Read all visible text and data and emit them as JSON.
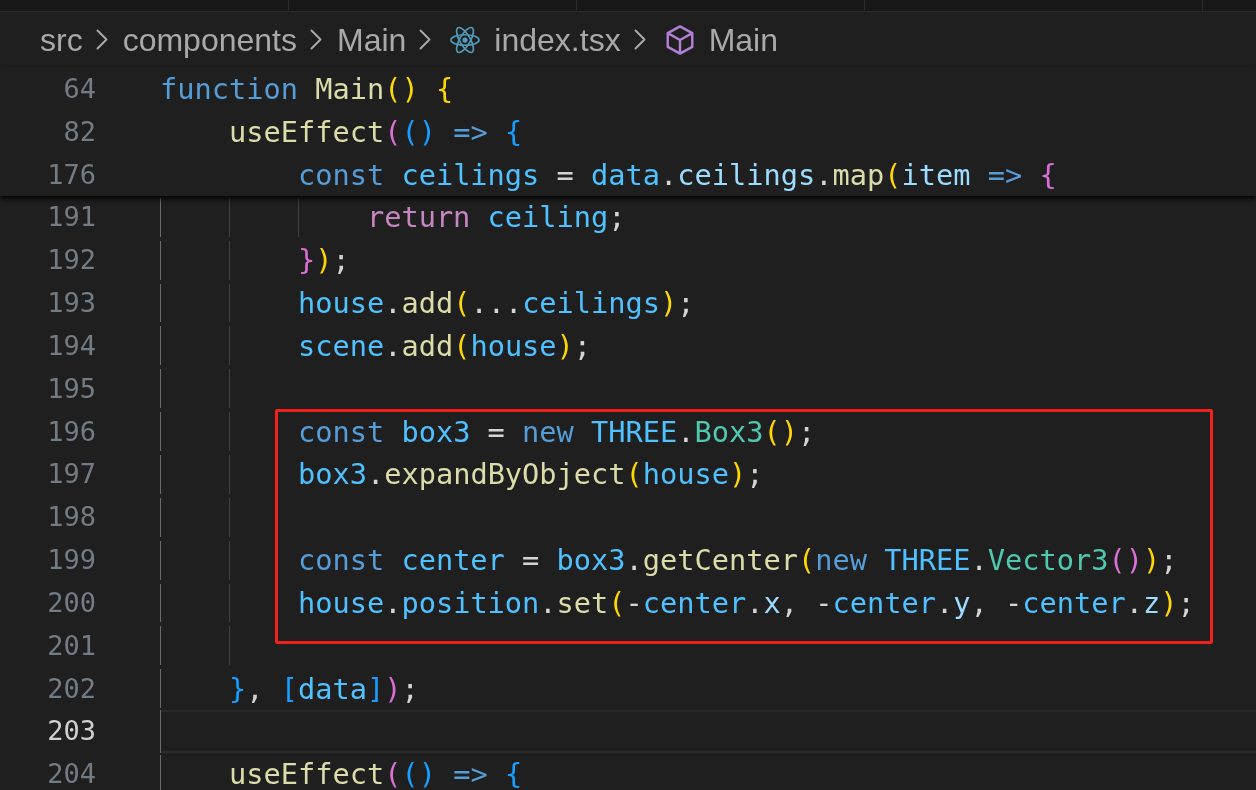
{
  "breadcrumb": [
    {
      "label": "src",
      "kind": "folder"
    },
    {
      "label": "components",
      "kind": "folder"
    },
    {
      "label": "Main",
      "kind": "folder"
    },
    {
      "label": "index.tsx",
      "kind": "file"
    },
    {
      "label": "Main",
      "kind": "symbol"
    }
  ],
  "code": [
    {
      "number": "64",
      "sticky": true,
      "current": false,
      "tokens": [
        {
          "text": "function",
          "kind": "keyword"
        },
        {
          "text": " Main",
          "kind": "function"
        },
        {
          "text": "()",
          "kind": "bracket1"
        },
        {
          "text": " {",
          "kind": "bracket1"
        }
      ],
      "children": [
        {
          "number": "82",
          "sticky": true,
          "current": false,
          "tokens": [
            {
              "text": "useEffect",
              "kind": "function"
            },
            {
              "text": "(",
              "kind": "bracket2"
            },
            {
              "text": "()",
              "kind": "bracket3"
            },
            {
              "text": " =>",
              "kind": "keyword"
            },
            {
              "text": " {",
              "kind": "bracket3"
            }
          ],
          "children": [
            {
              "kind": "line",
              "number": "176",
              "sticky": true,
              "current": false,
              "tokens": [
                {
                  "text": "const",
                  "kind": "keyword"
                },
                {
                  "text": " ceilings",
                  "kind": "constant"
                },
                {
                  "text": " = ",
                  "kind": "punctuation"
                },
                {
                  "text": "data",
                  "kind": "constant"
                },
                {
                  "text": ".",
                  "kind": "punctuation"
                },
                {
                  "text": "ceilings",
                  "kind": "property"
                },
                {
                  "text": ".",
                  "kind": "punctuation"
                },
                {
                  "text": "map",
                  "kind": "function"
                },
                {
                  "text": "(",
                  "kind": "bracket1"
                },
                {
                  "text": "item",
                  "kind": "property"
                },
                {
                  "text": " =>",
                  "kind": "keyword"
                },
                {
                  "text": " {",
                  "kind": "bracket2"
                }
              ],
              "children": [
                {
                  "number": "191",
                  "sticky": false,
                  "current": false,
                  "tokens": [
                    {
                      "text": "return",
                      "kind": "control"
                    },
                    {
                      "text": " ceiling",
                      "kind": "constant"
                    },
                    {
                      "text": ";",
                      "kind": "punctuation"
                    }
                  ]
                }
              ]
            },
            {
              "kind": "line",
              "number": "192",
              "sticky": false,
              "current": false,
              "tokens": [
                {
                  "text": "}",
                  "kind": "bracket2"
                },
                {
                  "text": ")",
                  "kind": "bracket1"
                },
                {
                  "text": ";",
                  "kind": "punctuation"
                }
              ]
            },
            {
              "kind": "line",
              "number": "193",
              "sticky": false,
              "current": false,
              "tokens": [
                {
                  "text": "house",
                  "kind": "constant"
                },
                {
                  "text": ".",
                  "kind": "punctuation"
                },
                {
                  "text": "add",
                  "kind": "function"
                },
                {
                  "text": "(",
                  "kind": "bracket1"
                },
                {
                  "text": "...",
                  "kind": "punctuation"
                },
                {
                  "text": "ceilings",
                  "kind": "constant"
                },
                {
                  "text": ")",
                  "kind": "bracket1"
                },
                {
                  "text": ";",
                  "kind": "punctuation"
                }
              ]
            },
            {
              "kind": "line",
              "number": "194",
              "sticky": false,
              "current": false,
              "tokens": [
                {
                  "text": "scene",
                  "kind": "constant"
                },
                {
                  "text": ".",
                  "kind": "punctuation"
                },
                {
                  "text": "add",
                  "kind": "function"
                },
                {
                  "text": "(",
                  "kind": "bracket1"
                },
                {
                  "text": "house",
                  "kind": "constant"
                },
                {
                  "text": ")",
                  "kind": "bracket1"
                },
                {
                  "text": ";",
                  "kind": "punctuation"
                }
              ]
            },
            {
              "kind": "line",
              "number": "195",
              "sticky": false,
              "current": false
            },
            {
              "kind": "highlight",
              "lines": [
                {
                  "number": "196",
                  "sticky": false,
                  "current": false,
                  "tokens": [
                    {
                      "text": "const",
                      "kind": "keyword"
                    },
                    {
                      "text": " box3",
                      "kind": "constant"
                    },
                    {
                      "text": " = ",
                      "kind": "punctuation"
                    },
                    {
                      "text": "new",
                      "kind": "keyword"
                    },
                    {
                      "text": " THREE",
                      "kind": "constant"
                    },
                    {
                      "text": ".",
                      "kind": "punctuation"
                    },
                    {
                      "text": "Box3",
                      "kind": "class"
                    },
                    {
                      "text": "()",
                      "kind": "bracket1"
                    },
                    {
                      "text": ";",
                      "kind": "punctuation"
                    }
                  ]
                },
                {
                  "number": "197",
                  "sticky": false,
                  "current": false,
                  "tokens": [
                    {
                      "text": "box3",
                      "kind": "constant"
                    },
                    {
                      "text": ".",
                      "kind": "punctuation"
                    },
                    {
                      "text": "expandByObject",
                      "kind": "function"
                    },
                    {
                      "text": "(",
                      "kind": "bracket1"
                    },
                    {
                      "text": "house",
                      "kind": "constant"
                    },
                    {
                      "text": ")",
                      "kind": "bracket1"
                    },
                    {
                      "text": ";",
                      "kind": "punctuation"
                    }
                  ]
                },
                {
                  "number": "198",
                  "sticky": false,
                  "current": false
                },
                {
                  "number": "199",
                  "sticky": false,
                  "current": false,
                  "tokens": [
                    {
                      "text": "const",
                      "kind": "keyword"
                    },
                    {
                      "text": " center",
                      "kind": "constant"
                    },
                    {
                      "text": " = ",
                      "kind": "punctuation"
                    },
                    {
                      "text": "box3",
                      "kind": "constant"
                    },
                    {
                      "text": ".",
                      "kind": "punctuation"
                    },
                    {
                      "text": "getCenter",
                      "kind": "function"
                    },
                    {
                      "text": "(",
                      "kind": "bracket1"
                    },
                    {
                      "text": "new",
                      "kind": "keyword"
                    },
                    {
                      "text": " THREE",
                      "kind": "constant"
                    },
                    {
                      "text": ".",
                      "kind": "punctuation"
                    },
                    {
                      "text": "Vector3",
                      "kind": "class"
                    },
                    {
                      "text": "()",
                      "kind": "bracket2"
                    },
                    {
                      "text": ")",
                      "kind": "bracket1"
                    },
                    {
                      "text": ";",
                      "kind": "punctuation"
                    }
                  ]
                },
                {
                  "number": "200",
                  "sticky": false,
                  "current": false,
                  "tokens": [
                    {
                      "text": "house",
                      "kind": "constant"
                    },
                    {
                      "text": ".",
                      "kind": "punctuation"
                    },
                    {
                      "text": "position",
                      "kind": "constant"
                    },
                    {
                      "text": ".",
                      "kind": "punctuation"
                    },
                    {
                      "text": "set",
                      "kind": "function"
                    },
                    {
                      "text": "(",
                      "kind": "bracket1"
                    },
                    {
                      "text": "-",
                      "kind": "punctuation"
                    },
                    {
                      "text": "center",
                      "kind": "constant"
                    },
                    {
                      "text": ".",
                      "kind": "punctuation"
                    },
                    {
                      "text": "x",
                      "kind": "property"
                    },
                    {
                      "text": ", -",
                      "kind": "punctuation"
                    },
                    {
                      "text": "center",
                      "kind": "constant"
                    },
                    {
                      "text": ".",
                      "kind": "punctuation"
                    },
                    {
                      "text": "y",
                      "kind": "property"
                    },
                    {
                      "text": ", -",
                      "kind": "punctuation"
                    },
                    {
                      "text": "center",
                      "kind": "constant"
                    },
                    {
                      "text": ".",
                      "kind": "punctuation"
                    },
                    {
                      "text": "z",
                      "kind": "property"
                    },
                    {
                      "text": ")",
                      "kind": "bracket1"
                    },
                    {
                      "text": ";",
                      "kind": "punctuation"
                    }
                  ]
                }
              ]
            },
            {
              "kind": "line",
              "number": "201",
              "sticky": false,
              "current": false
            }
          ]
        },
        {
          "number": "202",
          "sticky": false,
          "current": false,
          "tokens": [
            {
              "text": "}",
              "kind": "bracket3"
            },
            {
              "text": ", ",
              "kind": "punctuation"
            },
            {
              "text": "[",
              "kind": "bracket3"
            },
            {
              "text": "data",
              "kind": "constant"
            },
            {
              "text": "]",
              "kind": "bracket3"
            },
            {
              "text": ")",
              "kind": "bracket2"
            },
            {
              "text": ";",
              "kind": "punctuation"
            }
          ]
        },
        {
          "number": "203",
          "sticky": false,
          "current": true
        },
        {
          "number": "204",
          "sticky": false,
          "current": false,
          "tokens": [
            {
              "text": "useEffect",
              "kind": "function"
            },
            {
              "text": "(",
              "kind": "bracket2"
            },
            {
              "text": "()",
              "kind": "bracket3"
            },
            {
              "text": " =>",
              "kind": "keyword"
            },
            {
              "text": " {",
              "kind": "bracket3"
            }
          ]
        }
      ]
    }
  ]
}
